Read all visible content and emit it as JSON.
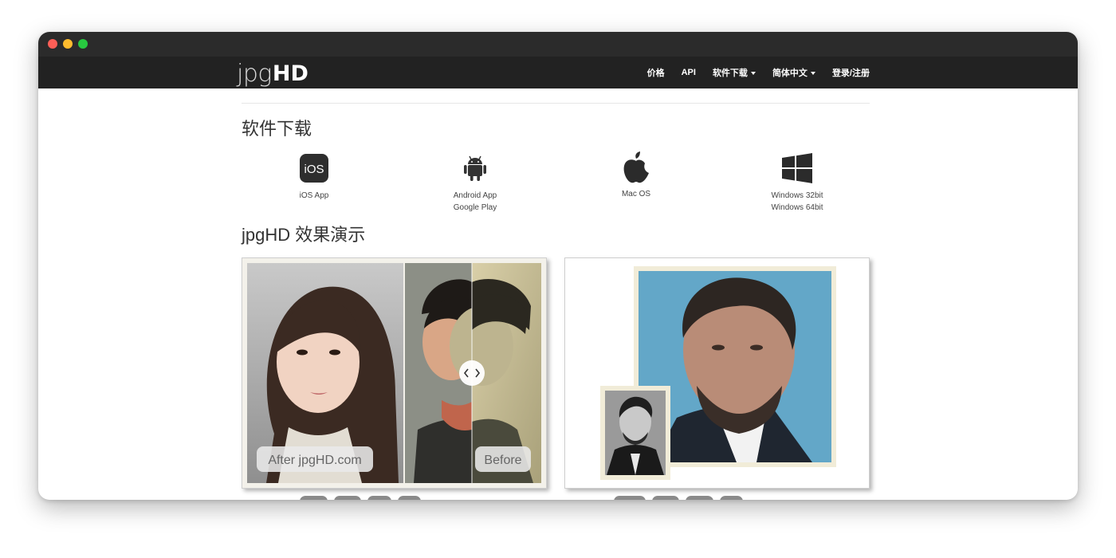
{
  "brand": {
    "light": "jpg",
    "bold": "HD"
  },
  "nav": {
    "items": [
      {
        "label": "价格",
        "caret": false
      },
      {
        "label": "API",
        "caret": false
      },
      {
        "label": "软件下载",
        "caret": true
      },
      {
        "label": "简体中文",
        "caret": true
      },
      {
        "label": "登录/注册",
        "caret": false
      }
    ]
  },
  "downloads": {
    "title": "软件下载",
    "ios": {
      "icon": "ios-icon",
      "glyph": "iOS",
      "lines": [
        "iOS App"
      ]
    },
    "android": {
      "icon": "android-icon",
      "lines": [
        "Android App",
        "Google Play"
      ]
    },
    "mac": {
      "icon": "apple-icon",
      "lines": [
        "Mac OS"
      ]
    },
    "windows": {
      "icon": "windows-icon",
      "lines": [
        "Windows 32bit",
        "Windows 64bit"
      ]
    }
  },
  "demo": {
    "title": "jpgHD 效果演示",
    "card1": {
      "after_label": "After jpgHD.com",
      "before_label": "Before"
    },
    "card2": {}
  },
  "colors": {
    "navbar": "#222222",
    "titlebar": "#2b2b2b",
    "accent_white": "#ffffff"
  }
}
